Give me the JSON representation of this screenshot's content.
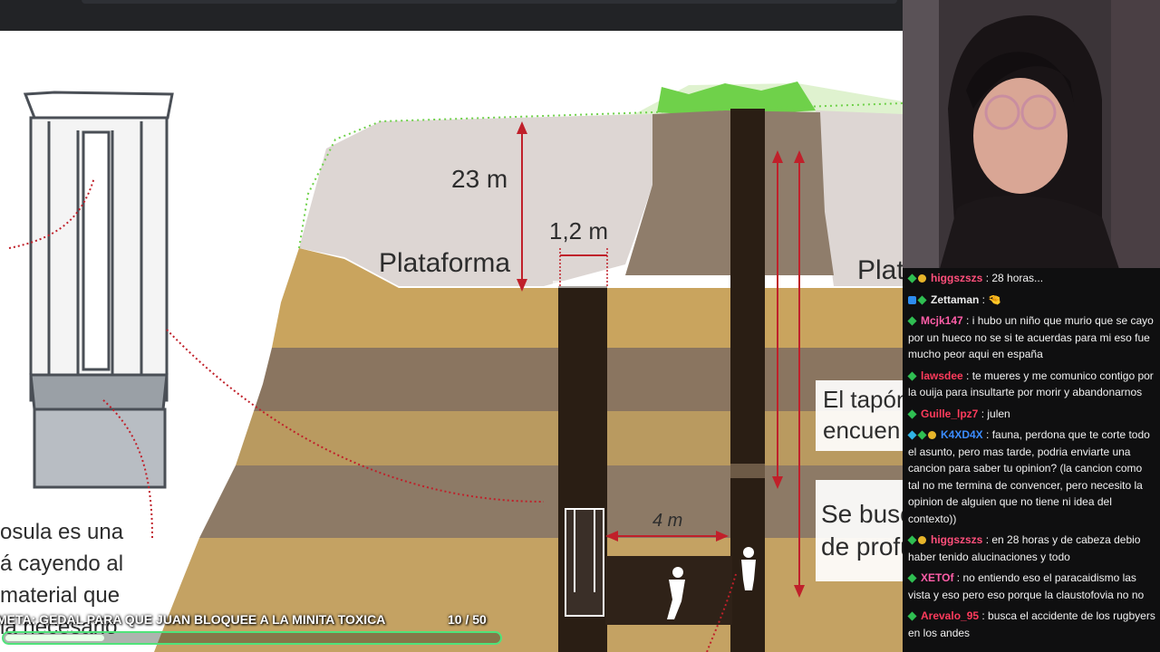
{
  "stream": {
    "goal_text": "META: GEDAL PARA QUE JUAN BLOQUEE A LA MINITA TOXICA",
    "goal_count": "10  / 50",
    "goal_progress": 0.2
  },
  "slide": {
    "labels": {
      "depth_23": "23 m",
      "width_12": "1,2 m",
      "plataforma": "Plataforma",
      "plataforma_right": "Plat",
      "distance_4": "4 m",
      "tapon_line1": "El tapón",
      "tapon_line2": "encuen",
      "busca_line1": "Se busc",
      "busca_line2": "de profu",
      "left_line1": "osula es una",
      "left_line2": "á cayendo al",
      "left_line3": "material que",
      "left_line4": "la necesario"
    }
  },
  "chat": {
    "messages": [
      {
        "user": "higgszszs",
        "text": ": 28 horas...",
        "color": "#ff4f7b",
        "badges": [
          "green",
          "gold"
        ]
      },
      {
        "user": "Zettaman",
        "text": ": 🤏",
        "color": "#e8e8e8",
        "badges": [
          "blue",
          "green"
        ]
      },
      {
        "user": "Mcjk147",
        "text": ": i hubo un niño que murio que se cayo por un hueco no se si te acuerdas para mi eso fue mucho peor aqui en españa",
        "color": "#ff5ea8",
        "badges": [
          "green"
        ]
      },
      {
        "user": "lawsdee",
        "text": ": te mueres y me comunico contigo por la ouija para insultarte por morir y abandonarnos",
        "color": "#ff3b5c",
        "badges": [
          "green"
        ]
      },
      {
        "user": "Guille_lpz7",
        "text": ": julen",
        "color": "#ff3b5c",
        "badges": [
          "green"
        ]
      },
      {
        "user": "K4XD4X",
        "text": ": fauna, perdona que te corte todo el asunto, pero mas tarde, podria enviarte una cancion para saber tu opinion? (la cancion como tal no me termina de convencer, pero necesito la opinion de alguien que no tiene ni idea del contexto))",
        "color": "#3b8cff",
        "badges": [
          "cyan",
          "green",
          "gold"
        ]
      },
      {
        "user": "higgszszs",
        "text": ": en 28 horas y de cabeza debio haber tenido alucinaciones y todo",
        "color": "#ff4f7b",
        "badges": [
          "green",
          "gold"
        ]
      },
      {
        "user": "XETOf",
        "text": ": no entiendo eso el paracaidismo las vista y eso pero eso porque la claustofovia no no",
        "color": "#ff5ea8",
        "badges": [
          "green"
        ]
      },
      {
        "user": "Arevalo_95",
        "text": ": busca el accidente de los rugbyers en los andes",
        "color": "#ff3b5c",
        "badges": [
          "green"
        ]
      }
    ]
  },
  "colors": {
    "goal_border": "#4fe37a",
    "soil_light": "#c9a45e",
    "soil_dark": "#8a7560",
    "shaft": "#2a1e14",
    "grass": "#6fd14a",
    "arrow_red": "#c0202a"
  }
}
